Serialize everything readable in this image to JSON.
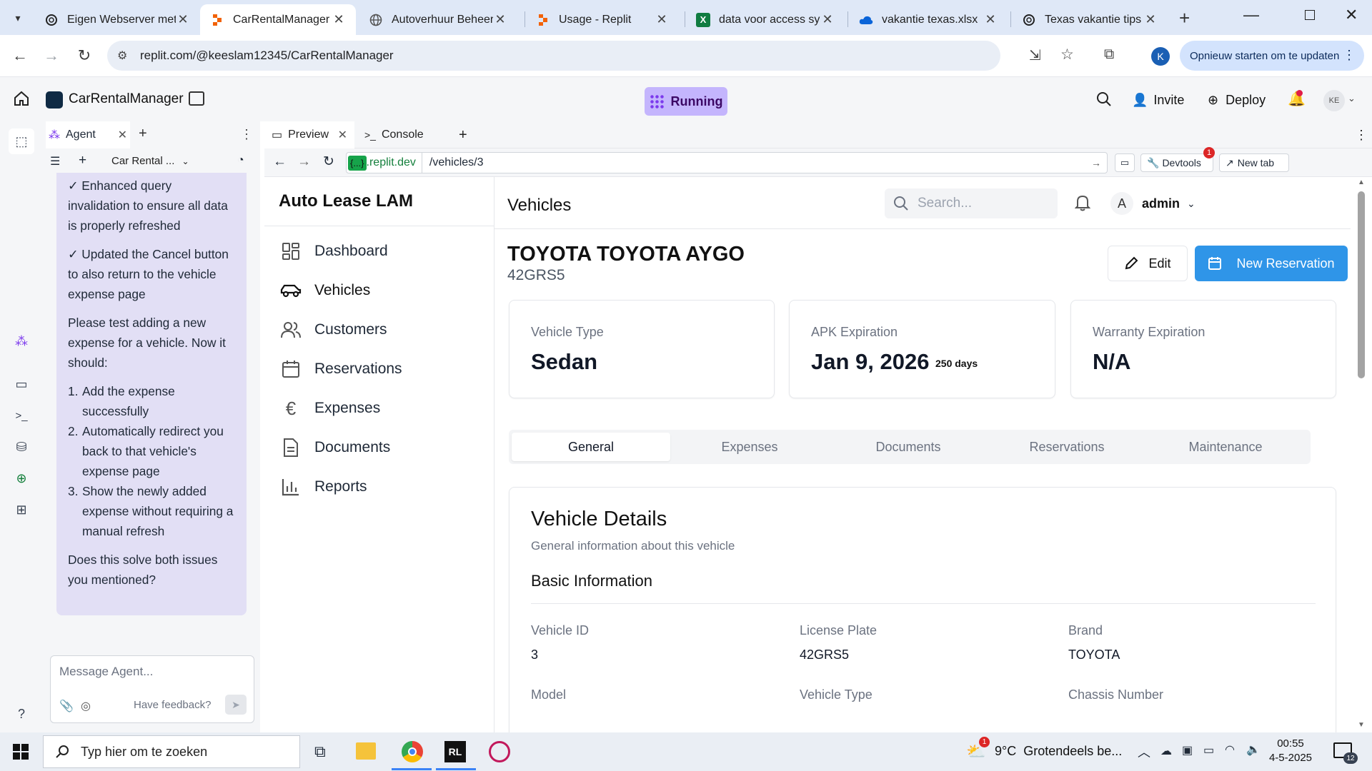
{
  "browser": {
    "tabs": [
      {
        "title": "Eigen Webserver met",
        "icon": "openai-icon"
      },
      {
        "title": "CarRentalManager - R",
        "icon": "replit-icon",
        "active": true
      },
      {
        "title": "Autoverhuur Beheer",
        "icon": "globe-icon"
      },
      {
        "title": "Usage - Replit",
        "icon": "replit-icon"
      },
      {
        "title": "data voor access syst",
        "icon": "excel-icon"
      },
      {
        "title": "vakantie texas.xlsx",
        "icon": "onedrive-icon"
      },
      {
        "title": "Texas vakantie tips",
        "icon": "openai-icon"
      }
    ],
    "url": "replit.com/@keeslam12345/CarRentalManager",
    "update_label": "Opnieuw starten om te updaten",
    "profile_initial": "K"
  },
  "replit": {
    "project_name": "CarRentalManager",
    "status": "Running",
    "invite_label": "Invite",
    "deploy_label": "Deploy",
    "avatar_initials": "KE"
  },
  "agent": {
    "tab_label": "Agent",
    "session_label": "Car Rental ...",
    "message": {
      "line1": "✓ Enhanced query invalidation to ensure all data is properly refreshed",
      "line2": "✓ Updated the Cancel button to also return to the vehicle expense page",
      "para": "Please test adding a new expense for a vehicle. Now it should:",
      "steps": [
        {
          "num": "1.",
          "text": "Add the expense successfully"
        },
        {
          "num": "2.",
          "text": "Automatically redirect you back to that vehicle's expense page"
        },
        {
          "num": "3.",
          "text": "Show the newly added expense without requiring a manual refresh"
        }
      ],
      "question": "Does this solve both issues you mentioned?"
    },
    "input_placeholder": "Message Agent...",
    "feedback_label": "Have feedback?"
  },
  "preview": {
    "tabs": [
      {
        "label": "Preview"
      },
      {
        "label": "Console"
      }
    ],
    "domain_badge": "{...}",
    "domain": ".replit.dev",
    "path": "/vehicles/3",
    "devtools_label": "Devtools",
    "devtools_badge": "1",
    "newtab_label": "New tab"
  },
  "app": {
    "brand": "Auto Lease LAM",
    "nav": [
      {
        "label": "Dashboard",
        "icon": "dashboard-icon"
      },
      {
        "label": "Vehicles",
        "icon": "car-icon",
        "active": true
      },
      {
        "label": "Customers",
        "icon": "users-icon"
      },
      {
        "label": "Reservations",
        "icon": "calendar-icon"
      },
      {
        "label": "Expenses",
        "icon": "euro-icon"
      },
      {
        "label": "Documents",
        "icon": "document-icon"
      },
      {
        "label": "Reports",
        "icon": "chart-icon"
      }
    ],
    "page_title": "Vehicles",
    "search_placeholder": "Search...",
    "user_initial": "A",
    "user_name": "admin",
    "vehicle_title": "TOYOTA TOYOTA AYGO",
    "vehicle_plate": "42GRS5",
    "edit_label": "Edit",
    "new_reservation_label": "New Reservation",
    "stats": [
      {
        "label": "Vehicle Type",
        "value": "Sedan"
      },
      {
        "label": "APK Expiration",
        "value": "Jan 9, 2026",
        "extra": "250 days"
      },
      {
        "label": "Warranty Expiration",
        "value": "N/A"
      }
    ],
    "tabs": [
      "General",
      "Expenses",
      "Documents",
      "Reservations",
      "Maintenance"
    ],
    "details_title": "Vehicle Details",
    "details_subtitle": "General information about this vehicle",
    "section_title": "Basic Information",
    "fields": [
      {
        "label": "Vehicle ID",
        "value": "3"
      },
      {
        "label": "License Plate",
        "value": "42GRS5"
      },
      {
        "label": "Brand",
        "value": "TOYOTA"
      },
      {
        "label": "Model",
        "value": ""
      },
      {
        "label": "Vehicle Type",
        "value": ""
      },
      {
        "label": "Chassis Number",
        "value": ""
      }
    ]
  },
  "taskbar": {
    "search_placeholder": "Typ hier om te zoeken",
    "weather": "9°C  Grotendeels be...",
    "weather_badge": "1",
    "time": "00:55",
    "date": "4-5-2025",
    "notif_count": "12"
  },
  "colors": {
    "accent_blue": "#2f95e8",
    "running_purple": "#c4b5fd",
    "agent_bubble": "#e2dff5",
    "tabstrip_bg": "#dfe8f7"
  }
}
